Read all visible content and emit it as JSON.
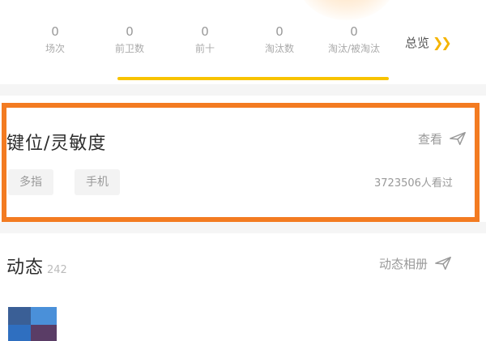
{
  "stats": [
    {
      "value": "0",
      "label": "场次"
    },
    {
      "value": "0",
      "label": "前卫数"
    },
    {
      "value": "0",
      "label": "前十"
    },
    {
      "value": "0",
      "label": "淘汰数"
    },
    {
      "value": "0",
      "label": "淘汰/被淘汰"
    }
  ],
  "overview_label": "总览",
  "overview_icon": "double-chevron-right-icon",
  "indicator_color": "#f8c300",
  "highlight_color": "#f37b21",
  "keymap": {
    "title": "键位/灵敏度",
    "view_label": "查看",
    "tags": [
      "多指",
      "手机"
    ],
    "views": "3723506人看过"
  },
  "moments": {
    "title": "动态",
    "count": "242",
    "album_label": "动态相册"
  },
  "icons": {
    "arrow": "paper-plane-arrow-icon"
  }
}
